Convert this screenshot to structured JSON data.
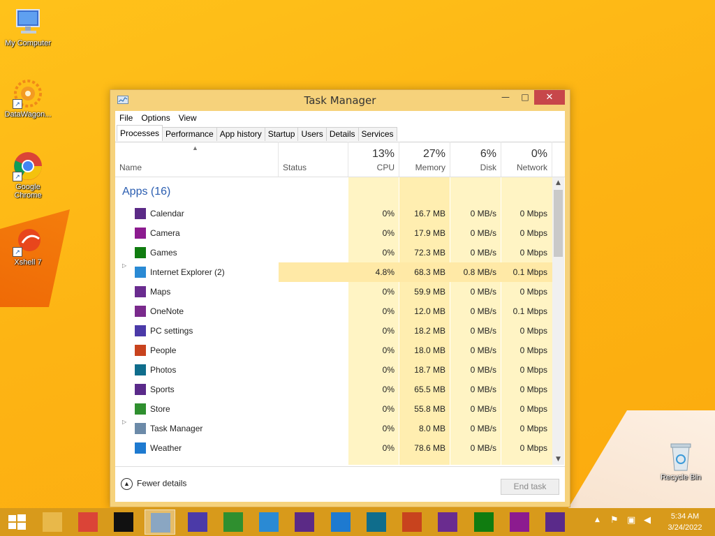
{
  "desktop": {
    "icons": [
      {
        "label": "My Computer"
      },
      {
        "label": "DataWagon..."
      },
      {
        "label": "Google Chrome"
      },
      {
        "label": "Xshell 7"
      },
      {
        "label": "Recycle Bin"
      }
    ]
  },
  "window": {
    "title": "Task Manager",
    "controls": {
      "minimize": "—",
      "maximize": "□",
      "close": "✕"
    },
    "menu": [
      "File",
      "Options",
      "View"
    ],
    "tabs": [
      "Processes",
      "Performance",
      "App history",
      "Startup",
      "Users",
      "Details",
      "Services"
    ],
    "active_tab": "Processes",
    "columns": {
      "name": "Name",
      "status": "Status",
      "cpu": {
        "pct": "13%",
        "label": "CPU"
      },
      "memory": {
        "pct": "27%",
        "label": "Memory"
      },
      "disk": {
        "pct": "6%",
        "label": "Disk"
      },
      "network": {
        "pct": "0%",
        "label": "Network"
      }
    },
    "group_title": "Apps (16)",
    "rows": [
      {
        "name": "Calendar",
        "icon": "calendar-icon",
        "cpu": "0%",
        "memory": "16.7 MB",
        "disk": "0 MB/s",
        "network": "0 Mbps",
        "expandable": false
      },
      {
        "name": "Camera",
        "icon": "camera-icon",
        "cpu": "0%",
        "memory": "17.9 MB",
        "disk": "0 MB/s",
        "network": "0 Mbps",
        "expandable": false
      },
      {
        "name": "Games",
        "icon": "games-icon",
        "cpu": "0%",
        "memory": "72.3 MB",
        "disk": "0 MB/s",
        "network": "0 Mbps",
        "expandable": false
      },
      {
        "name": "Internet Explorer (2)",
        "icon": "internet-explorer-icon",
        "cpu": "4.8%",
        "memory": "68.3 MB",
        "disk": "0.8 MB/s",
        "network": "0.1 Mbps",
        "expandable": true
      },
      {
        "name": "Maps",
        "icon": "maps-icon",
        "cpu": "0%",
        "memory": "59.9 MB",
        "disk": "0 MB/s",
        "network": "0 Mbps",
        "expandable": false
      },
      {
        "name": "OneNote",
        "icon": "onenote-icon",
        "cpu": "0%",
        "memory": "12.0 MB",
        "disk": "0 MB/s",
        "network": "0.1 Mbps",
        "expandable": false
      },
      {
        "name": "PC settings",
        "icon": "gear-icon",
        "cpu": "0%",
        "memory": "18.2 MB",
        "disk": "0 MB/s",
        "network": "0 Mbps",
        "expandable": false
      },
      {
        "name": "People",
        "icon": "people-icon",
        "cpu": "0%",
        "memory": "18.0 MB",
        "disk": "0 MB/s",
        "network": "0 Mbps",
        "expandable": false
      },
      {
        "name": "Photos",
        "icon": "photos-icon",
        "cpu": "0%",
        "memory": "18.7 MB",
        "disk": "0 MB/s",
        "network": "0 Mbps",
        "expandable": false
      },
      {
        "name": "Sports",
        "icon": "trophy-icon",
        "cpu": "0%",
        "memory": "65.5 MB",
        "disk": "0 MB/s",
        "network": "0 Mbps",
        "expandable": false
      },
      {
        "name": "Store",
        "icon": "store-icon",
        "cpu": "0%",
        "memory": "55.8 MB",
        "disk": "0 MB/s",
        "network": "0 Mbps",
        "expandable": false
      },
      {
        "name": "Task Manager",
        "icon": "task-manager-icon",
        "cpu": "0%",
        "memory": "8.0 MB",
        "disk": "0 MB/s",
        "network": "0 Mbps",
        "expandable": true
      },
      {
        "name": "Weather",
        "icon": "weather-icon",
        "cpu": "0%",
        "memory": "78.6 MB",
        "disk": "0 MB/s",
        "network": "0 Mbps",
        "expandable": false
      }
    ],
    "footer": {
      "fewer_details": "Fewer details",
      "end_task": "End task"
    }
  },
  "taskbar": {
    "colors": {
      "bar": "#d89a1b"
    },
    "items": [
      "start-icon",
      "file-explorer-icon",
      "chrome-icon",
      "terminal-icon",
      "task-manager-icon",
      "gear-icon",
      "store-icon",
      "internet-explorer-icon",
      "calendar-icon",
      "weather-icon",
      "photos-icon",
      "people-icon",
      "maps-icon",
      "games-icon",
      "camera-icon",
      "trophy-icon"
    ],
    "clock": {
      "time": "5:34 AM",
      "date": "3/24/2022"
    }
  }
}
